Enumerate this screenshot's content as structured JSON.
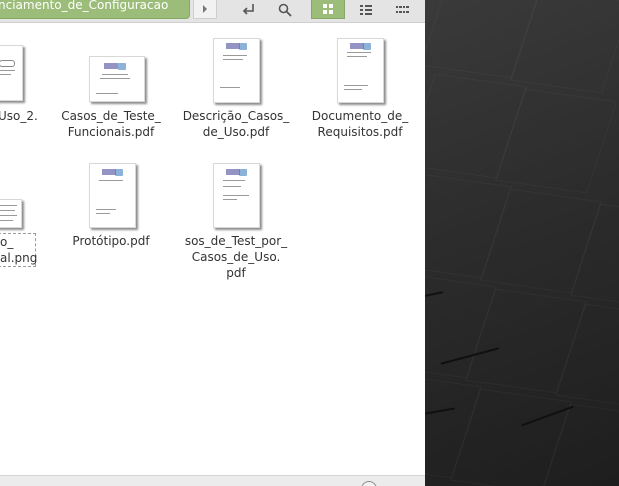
{
  "toolbar": {
    "path_label": "nciamento_de_Configuracao"
  },
  "files": [
    {
      "name": "Uso_2.",
      "selected": false
    },
    {
      "name": "Casos_de_Teste_\nFuncionais.pdf",
      "selected": false
    },
    {
      "name": "Descrição_Casos_\nde_Uso.pdf",
      "selected": false
    },
    {
      "name": "Documento_de_\nRequisitos.pdf",
      "selected": false
    },
    {
      "name": "o_\nal.png",
      "selected": true
    },
    {
      "name": "Protótipo.pdf",
      "selected": false
    },
    {
      "name": "sos_de_Test_por_\nCasos_de_Uso.\npdf",
      "selected": false
    }
  ],
  "colors": {
    "accent": "#9cbd7a",
    "text": "#333333"
  }
}
